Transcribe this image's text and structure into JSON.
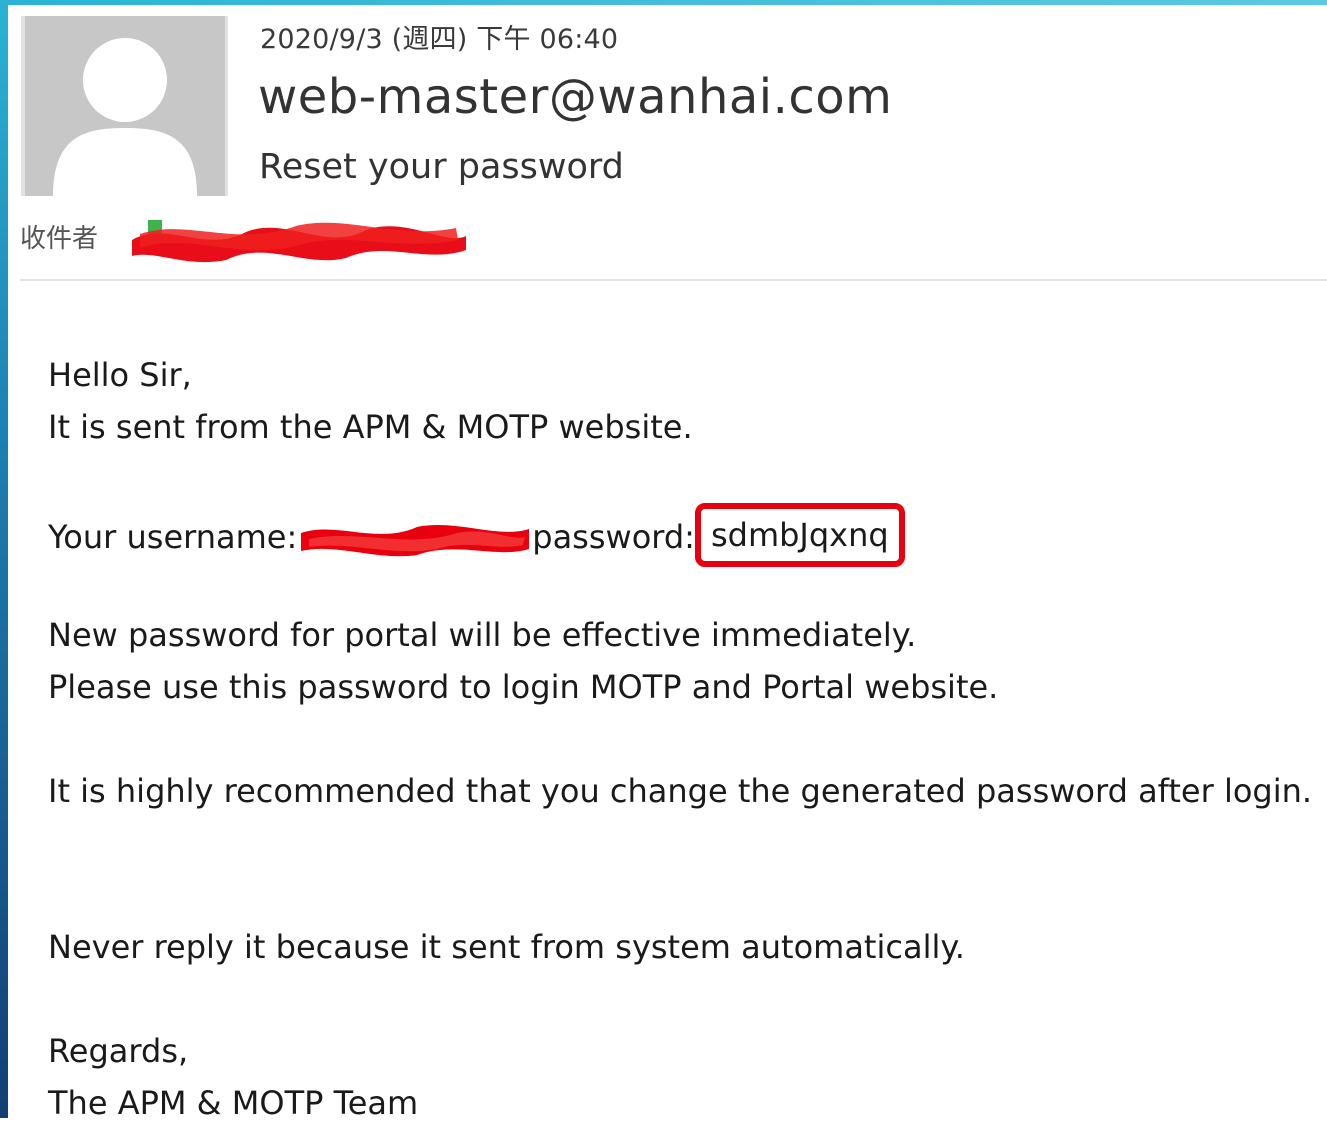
{
  "message": {
    "date": "2020/9/3 (週四) 下午 06:40",
    "sender": "web-master@wanhai.com",
    "subject": "Reset your password",
    "recipient_label": "收件者"
  },
  "body": {
    "greeting": "Hello Sir,",
    "intro": "It is sent from the APM & MOTP website.",
    "username_label": "Your username:",
    "password_label": "password:",
    "password_value": "sdmbJqxnq",
    "effective": "New password for portal will be effective immediately.",
    "usage": "Please use this password to login MOTP and Portal website.",
    "recommend": "It is highly recommended that you change the generated password after login.",
    "no_reply": "Never reply it because it sent from system automatically.",
    "regards": "Regards,",
    "signature": "The APM & MOTP Team"
  },
  "colors": {
    "highlight_box": "#e8000e",
    "redaction": "#e8000e",
    "avatar_bg": "#c7c7c7"
  },
  "icons": {
    "avatar": "person-silhouette-icon"
  }
}
